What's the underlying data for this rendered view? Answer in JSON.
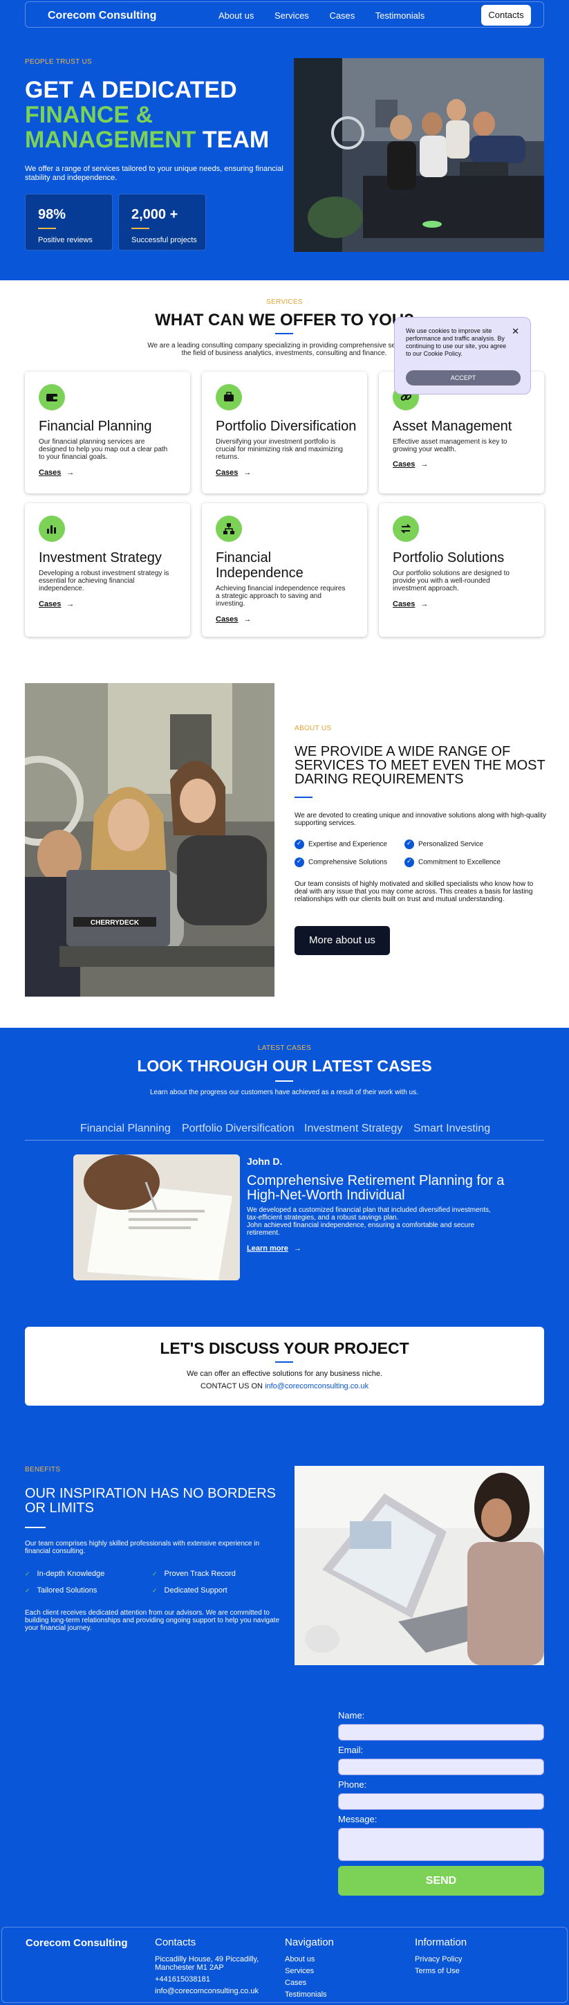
{
  "header": {
    "brand": "Corecom Consulting",
    "links": [
      "About us",
      "Services",
      "Cases",
      "Testimonials"
    ],
    "contacts_btn": "Contacts"
  },
  "hero": {
    "kicker": "PEOPLE TRUST US",
    "title_line1": "GET A DEDICATED",
    "title_line2": "FINANCE &",
    "title_line3a": "MANAGEMENT",
    "title_line3b": " TEAM",
    "description": "We offer a range of services tailored to your unique needs, ensuring financial stability and independence.",
    "stats": [
      {
        "value": "98%",
        "label": "Positive reviews"
      },
      {
        "value": "2,000 +",
        "label": "Successful projects"
      }
    ]
  },
  "services": {
    "kicker": "SERVICES",
    "title": "WHAT CAN WE OFFER TO YOU?",
    "description": "We are a leading consulting company specializing in providing comprehensive services in the field of business analytics, investments, consulting and finance.",
    "cards": [
      {
        "icon": "wallet-icon",
        "title": "Financial Planning",
        "desc": "Our financial planning services are designed to help you map out a clear path to your financial goals.",
        "link": "Cases"
      },
      {
        "icon": "briefcase-icon",
        "title": "Portfolio Diversification",
        "desc": "Diversifying your investment portfolio is crucial for minimizing risk and maximizing returns.",
        "link": "Cases"
      },
      {
        "icon": "link-icon",
        "title": "Asset Management",
        "desc": "Effective asset management is key to growing your wealth.",
        "link": "Cases"
      },
      {
        "icon": "bar-chart-icon",
        "title": "Investment Strategy",
        "desc": "Developing a robust investment strategy is essential for achieving financial independence.",
        "link": "Cases"
      },
      {
        "icon": "network-icon",
        "title": "Financial Independence",
        "desc": "Achieving financial independence requires a strategic approach to saving and investing.",
        "link": "Cases"
      },
      {
        "icon": "transfer-icon",
        "title": "Portfolio Solutions",
        "desc": "Our portfolio solutions are designed to provide you with a well-rounded investment approach.",
        "link": "Cases"
      }
    ]
  },
  "cookie": {
    "text": "We use cookies to improve site performance and traffic analysis. By continuing to use our site, you agree to our Cookie Policy.",
    "button": "ACCEPT"
  },
  "about": {
    "kicker": "ABOUT US",
    "title": "WE PROVIDE A WIDE RANGE OF SERVICES TO MEET EVEN THE MOST DARING REQUIREMENTS",
    "intro": "We are devoted to creating unique and innovative solutions along with high-quality supporting services.",
    "features": [
      "Expertise and Experience",
      "Personalized Service",
      "Comprehensive Solutions",
      "Commitment to Excellence"
    ],
    "body": "Our team consists of highly motivated and skilled specialists who know how to deal with any issue that you may come across. This creates a basis for lasting relationships with our clients built on trust and mutual understanding.",
    "button": "More about us",
    "laptop_sticker": "CHERRYDECK"
  },
  "cases": {
    "kicker": "LATEST CASES",
    "title": "LOOK THROUGH OUR LATEST CASES",
    "description": "Learn about the progress our customers have achieved as a result of their work with us.",
    "tabs": [
      "Financial Planning",
      "Portfolio Diversification",
      "Investment Strategy",
      "Smart Investing"
    ],
    "case": {
      "client": "John D.",
      "title": "Comprehensive Retirement Planning for a High-Net-Worth Individual",
      "body1": "We developed a customized financial plan that included diversified investments, tax-efficient strategies, and a robust savings plan.",
      "body2": "John achieved financial independence, ensuring a comfortable and secure retirement.",
      "link": "Learn more"
    }
  },
  "discuss": {
    "title": "LET'S DISCUSS YOUR PROJECT",
    "subtitle": "We can offer an effective solutions for any business niche.",
    "contact_prefix": "CONTACT US ON ",
    "email": "info@corecomconsulting.co.uk"
  },
  "benefits": {
    "kicker": "BENEFITS",
    "title": "OUR INSPIRATION HAS NO BORDERS OR LIMITS",
    "intro": "Our team comprises highly skilled professionals with extensive experience in financial consulting.",
    "items": [
      "In-depth Knowledge",
      "Proven Track Record",
      "Tailored Solutions",
      "Dedicated Support"
    ],
    "body": "Each client receives dedicated attention from our advisors. We are committed to building long-term relationships and providing ongoing support to help you navigate your financial journey."
  },
  "form": {
    "name_label": "Name:",
    "email_label": "Email:",
    "phone_label": "Phone:",
    "message_label": "Message:",
    "send": "SEND"
  },
  "footer": {
    "brand": "Corecom Consulting",
    "contacts_title": "Contacts",
    "address": "Piccadilly House, 49 Piccadilly, Manchester M1 2AP",
    "phone": "+441615038181",
    "email": "info@corecomconsulting.co.uk",
    "nav_title": "Navigation",
    "nav": [
      "About us",
      "Services",
      "Cases",
      "Testimonials"
    ],
    "info_title": "Information",
    "info": [
      "Privacy Policy",
      "Terms of Use"
    ]
  },
  "colors": {
    "primary": "#0a56d8",
    "accent_green": "#7bd257",
    "accent_gold": "#f2b742",
    "dark": "#0e1428"
  }
}
